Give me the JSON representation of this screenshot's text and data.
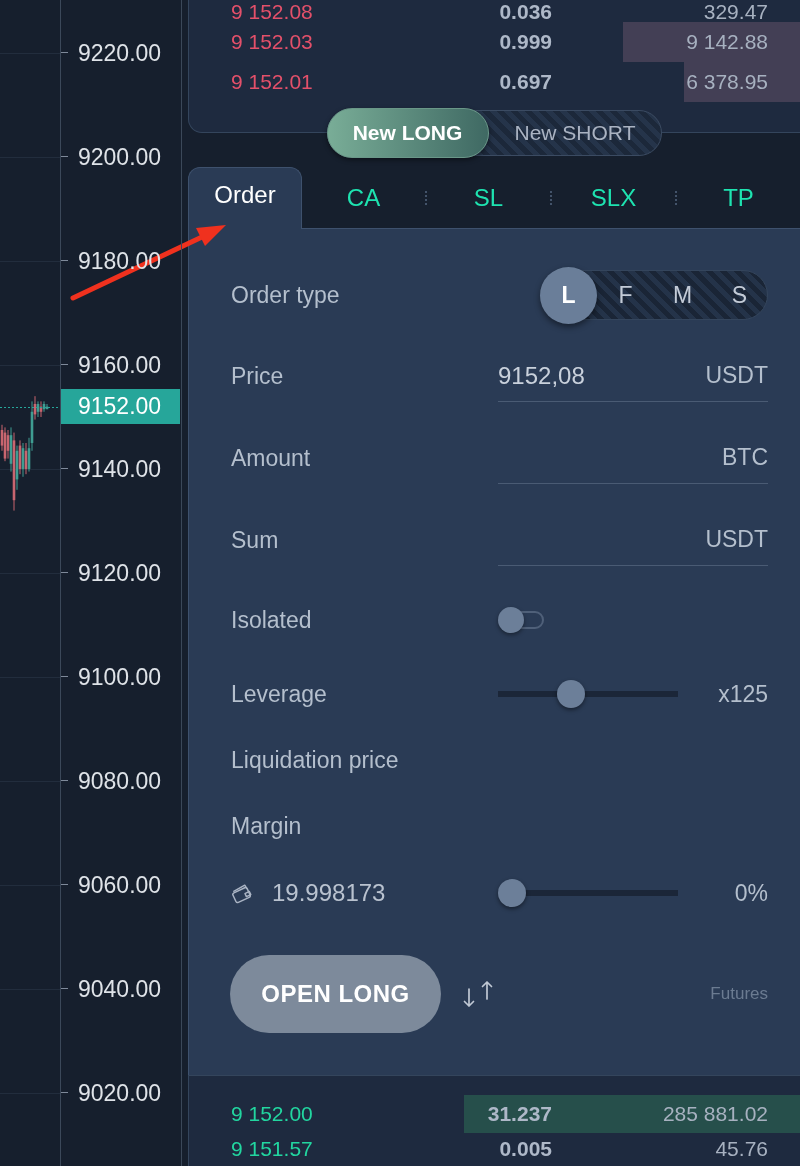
{
  "chart": {
    "chart_data": {
      "type": "candlestick",
      "ohlc": [
        [
          9147.5,
          9148.5,
          9143.5,
          9144.5
        ],
        [
          9147,
          9148,
          9141.5,
          9142
        ],
        [
          9146.5,
          9147.5,
          9142,
          9143.5
        ],
        [
          9141,
          9148,
          9139.5,
          9146.5
        ],
        [
          9145.5,
          9147,
          9132,
          9134
        ],
        [
          9138,
          9144.5,
          9136,
          9143.5
        ],
        [
          9144.5,
          9145.5,
          9139,
          9140
        ],
        [
          9140,
          9145,
          9138.5,
          9144
        ],
        [
          9143.5,
          9145,
          9139,
          9140
        ],
        [
          9140,
          9146,
          9139.5,
          9144
        ],
        [
          9145,
          9153,
          9143.5,
          9151
        ],
        [
          9152.5,
          9154,
          9149.5,
          9150.5
        ],
        [
          9151,
          9153,
          9150,
          9152.5
        ],
        [
          9152,
          9153,
          9150,
          9151
        ],
        [
          9151.5,
          9153,
          9151,
          9152.5
        ],
        [
          9151.5,
          9152.5,
          9151.5,
          9152
        ]
      ],
      "ylim": [
        9005.96,
        9230.19
      ],
      "yticks": [
        {
          "value": 9220,
          "label": "9220.00"
        },
        {
          "value": 9200,
          "label": "9200.00"
        },
        {
          "value": 9180,
          "label": "9180.00"
        },
        {
          "value": 9160,
          "label": "9160.00"
        },
        {
          "value": 9140,
          "label": "9140.00"
        },
        {
          "value": 9120,
          "label": "9120.00"
        },
        {
          "value": 9100,
          "label": "9100.00"
        },
        {
          "value": 9080,
          "label": "9080.00"
        },
        {
          "value": 9060,
          "label": "9060.00"
        },
        {
          "value": 9040,
          "label": "9040.00"
        },
        {
          "value": 9020,
          "label": "9020.00"
        }
      ],
      "grid": true,
      "ref_lines": [
        {
          "axis": "y",
          "value": 9152,
          "label": "9152.00"
        }
      ]
    }
  },
  "asks": [
    {
      "price": "9 152.08",
      "amount": "0.036",
      "total": "329.47"
    },
    {
      "price": "9 152.03",
      "amount": "0.999",
      "total": "9 142.88",
      "level": 0.29
    },
    {
      "price": "9 152.01",
      "amount": "0.697",
      "total": "6 378.95",
      "level": 0.19
    }
  ],
  "side_toggle": [
    {
      "label": "New LONG",
      "selected": true
    },
    {
      "label": "New SHORT",
      "selected": false
    }
  ],
  "tabs": [
    {
      "label": "Order",
      "selected": true
    },
    {
      "label": "CA",
      "selected": false
    },
    {
      "label": "SL",
      "selected": false
    },
    {
      "label": "SLX",
      "selected": false
    },
    {
      "label": "TP",
      "selected": false
    }
  ],
  "order_form": {
    "order_type": {
      "label": "Order type",
      "options": [
        {
          "label": "L",
          "selected": true
        },
        {
          "label": "F",
          "selected": false
        },
        {
          "label": "M",
          "selected": false
        },
        {
          "label": "S",
          "selected": false
        }
      ]
    },
    "fields": [
      {
        "label": "Price",
        "value": "9152,08",
        "unit": "USDT"
      },
      {
        "label": "Amount",
        "unit": "BTC"
      },
      {
        "label": "Sum",
        "unit": "USDT"
      }
    ],
    "isolated": {
      "label": "Isolated",
      "on": false
    },
    "leverage": {
      "label": "Leverage",
      "level": 0.39,
      "reading": "x125"
    },
    "liquidation_price": {
      "label": "Liquidation price"
    },
    "margin": {
      "label": "Margin",
      "balance": "19.998173",
      "level": 0,
      "reading": "0%"
    },
    "submit": {
      "label": "OPEN LONG"
    },
    "market": "Futures"
  },
  "bids": [
    {
      "price": "9 152.00",
      "amount": "31.237",
      "total": "285 881.02",
      "level": 0.55
    },
    {
      "price": "9 151.57",
      "amount": "0.005",
      "total": "45.76"
    }
  ]
}
